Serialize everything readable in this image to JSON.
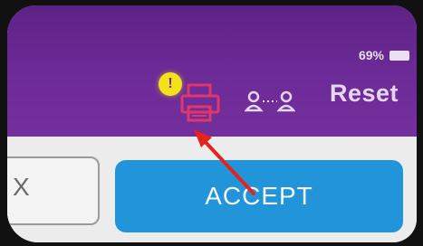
{
  "status_bar": {
    "battery_text": "69%",
    "battery_icon": "battery-icon"
  },
  "toolbar": {
    "printer_icon": "printer-alert-icon",
    "alert_badge_text": "!",
    "pair_icon": "pair-devices-icon",
    "reset_label": "Reset"
  },
  "dialog": {
    "left_button_label": "X",
    "accept_label": "ACCEPT"
  },
  "colors": {
    "toolbar_purple": "#6d2b97",
    "accept_blue": "#2294d9",
    "alert_yellow": "#f3e21b",
    "printer_red": "#e0366a",
    "arrow_red": "#e5231b"
  }
}
